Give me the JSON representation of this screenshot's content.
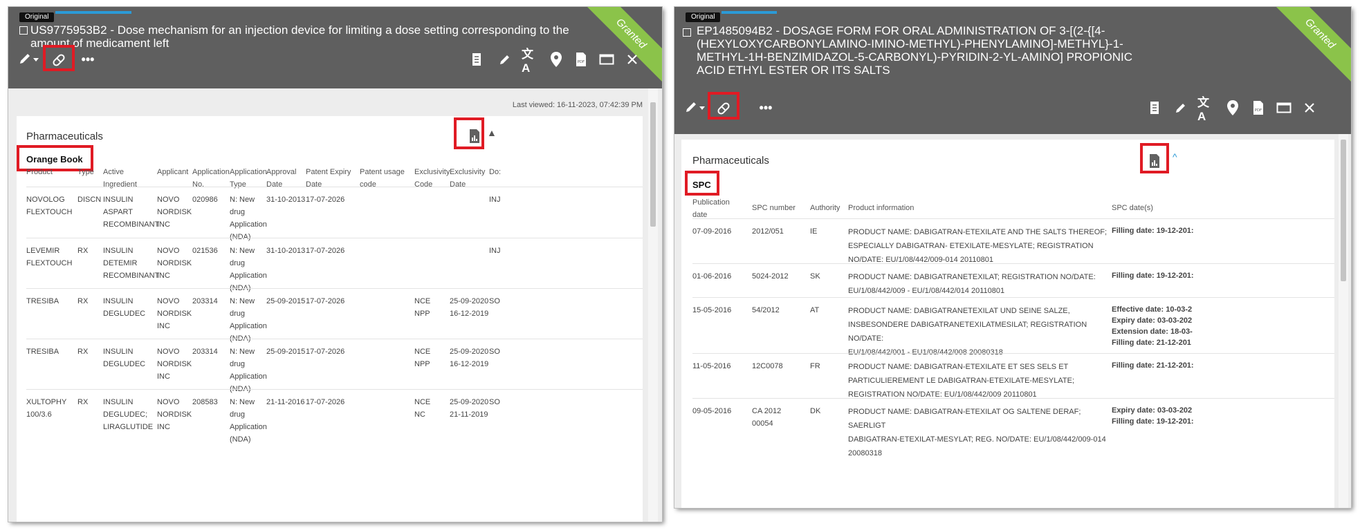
{
  "left_panel": {
    "badge": "Original",
    "title": "US9775953B2 - Dose mechanism for an injection device for limiting a dose setting corresponding to the amount of medicament left",
    "status": "Granted",
    "last_viewed": "Last viewed: 16-11-2023, 07:42:39 PM",
    "section_title": "Pharmaceuticals",
    "sub_label": "Orange Book",
    "columns": [
      "Product",
      "Type",
      "Active\nIngredient",
      "Applicant",
      "Application\nNo.",
      "Application\nType",
      "Approval\nDate",
      "Patent Expiry\nDate",
      "Patent usage\ncode",
      "Exclusivity\nCode",
      "Exclusivity\nDate",
      "Do:"
    ],
    "rows": [
      [
        "NOVOLOG\nFLEXTOUCH",
        "DISCN",
        "INSULIN\nASPART\nRECOMBINANT",
        "NOVO\nNORDISK\nINC",
        "020986",
        "N: New\ndrug\nApplication\n(NDA)",
        "31-10-2013",
        "17-07-2026",
        "",
        "",
        "",
        "INJ"
      ],
      [
        "LEVEMIR\nFLEXTOUCH",
        "RX",
        "INSULIN\nDETEMIR\nRECOMBINANT",
        "NOVO\nNORDISK\nINC",
        "021536",
        "N: New\ndrug\nApplication\n(NDA)",
        "31-10-2013",
        "17-07-2026",
        "",
        "",
        "",
        "INJ"
      ],
      [
        "TRESIBA",
        "RX",
        "INSULIN\nDEGLUDEC",
        "NOVO\nNORDISK\nINC",
        "203314",
        "N: New\ndrug\nApplication\n(NDA)",
        "25-09-2015",
        "17-07-2026",
        "",
        "NCE\nNPP",
        "25-09-2020\n16-12-2019",
        "SO"
      ],
      [
        "TRESIBA",
        "RX",
        "INSULIN\nDEGLUDEC",
        "NOVO\nNORDISK\nINC",
        "203314",
        "N: New\ndrug\nApplication\n(NDA)",
        "25-09-2015",
        "17-07-2026",
        "",
        "NCE\nNPP",
        "25-09-2020\n16-12-2019",
        "SO"
      ],
      [
        "XULTOPHY\n100/3.6",
        "RX",
        "INSULIN\nDEGLUDEC;\nLIRAGLUTIDE",
        "NOVO\nNORDISK\nINC",
        "208583",
        "N: New\ndrug\nApplication\n(NDA)",
        "21-11-2016",
        "17-07-2026",
        "",
        "NCE\nNC",
        "25-09-2020\n21-11-2019",
        "SO"
      ]
    ]
  },
  "right_panel": {
    "badge": "Original",
    "title": "EP1485094B2 - DOSAGE FORM FOR ORAL ADMINISTRATION OF 3-[(2-{[4-(HEXYLOXYCARBONYLAMINO-IMINO-METHYL)-PHENYLAMINO]-METHYL}-1-METHYL-1H-BENZIMIDAZOL-5-CARBONYL)-PYRIDIN-2-YL-AMINO] PROPIONIC ACID ETHYL ESTER OR ITS SALTS",
    "status": "Granted",
    "section_title": "Pharmaceuticals",
    "sub_label": "SPC",
    "columns": [
      "Publication\ndate",
      "SPC number",
      "Authority",
      "Product information",
      "SPC date(s)"
    ],
    "rows": [
      [
        "07-09-2016",
        "2012/051",
        "IE",
        "PRODUCT NAME: DABIGATRAN-ETEXILATE AND THE SALTS THEREOF;\nESPECIALLY DABIGATRAN- ETEXILATE-MESYLATE; REGISTRATION\nNO/DATE: EU/1/08/442/009-014 20110801",
        "Filling date: 19-12-201:"
      ],
      [
        "01-06-2016",
        "5024-2012",
        "SK",
        "PRODUCT NAME: DABIGATRANETEXILAT; REGISTRATION NO/DATE:\nEU/1/08/442/009 - EU/1/08/442/014 20110801",
        "Filling date: 19-12-201:"
      ],
      [
        "15-05-2016",
        "54/2012",
        "AT",
        "PRODUCT NAME: DABIGATRANETEXILAT UND SEINE SALZE,\nINSBESONDERE DABIGATRANETEXILATMESILAT; REGISTRATION NO/DATE:\nEU/1/08/442/001 - EU1/08/442/008 20080318",
        "Effective date: 10-03-2\nExpiry date: 03-03-202\nExtension date: 18-03-\nFilling date: 21-12-201"
      ],
      [
        "11-05-2016",
        "12C0078",
        "FR",
        "PRODUCT NAME: DABIGATRAN-ETEXILATE ET SES SELS ET\nPARTICULIEREMENT LE DABIGATRAN-ETEXILATE-MESYLATE;\nREGISTRATION NO/DATE: EU/1/08/442/009 20110801",
        "Filling date: 21-12-201:"
      ],
      [
        "09-05-2016",
        "CA 2012\n00054",
        "DK",
        "PRODUCT NAME: DABIGATRAN-ETEXILAT OG SALTENE DERAF; SAERLIGT\nDABIGATRAN-ETEXILAT-MESYLAT; REG. NO/DATE: EU/1/08/442/009-014\n20080318",
        "Expiry date: 03-03-202\nFilling date: 19-12-201:"
      ]
    ]
  }
}
